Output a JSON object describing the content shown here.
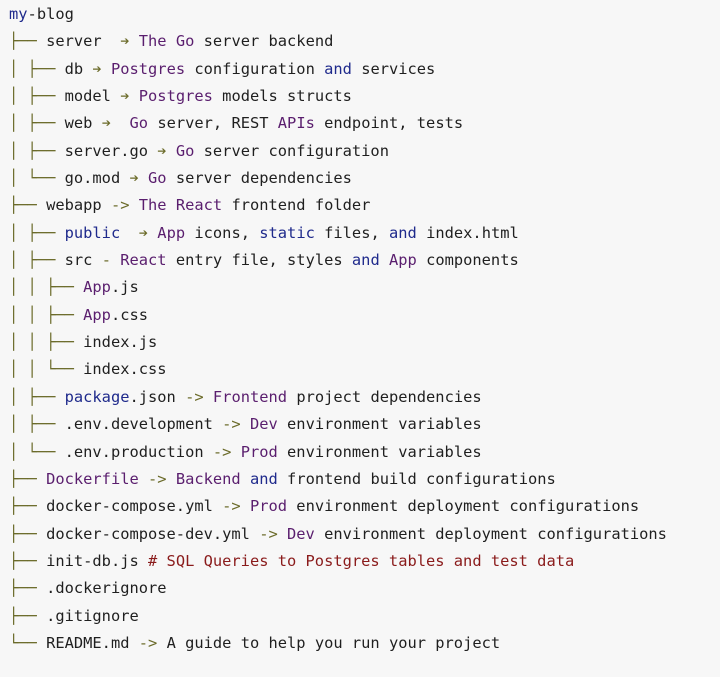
{
  "lines": [
    {
      "tree": "",
      "segs": [
        {
          "t": "my",
          "c": "navy"
        },
        {
          "t": "-",
          "c": "black"
        },
        {
          "t": "blog",
          "c": "black"
        }
      ]
    },
    {
      "tree": "├── ",
      "segs": [
        {
          "t": "server  ",
          "c": "black"
        },
        {
          "t": "➔ ",
          "c": "olive"
        },
        {
          "t": "The Go ",
          "c": "purple"
        },
        {
          "t": "server backend",
          "c": "black"
        }
      ]
    },
    {
      "tree": "│ ├── ",
      "segs": [
        {
          "t": "db ",
          "c": "black"
        },
        {
          "t": "➔ ",
          "c": "olive"
        },
        {
          "t": "Postgres ",
          "c": "purple"
        },
        {
          "t": "configuration ",
          "c": "black"
        },
        {
          "t": "and ",
          "c": "navy"
        },
        {
          "t": "services",
          "c": "black"
        }
      ]
    },
    {
      "tree": "│ ├── ",
      "segs": [
        {
          "t": "model ",
          "c": "black"
        },
        {
          "t": "➔ ",
          "c": "olive"
        },
        {
          "t": "Postgres ",
          "c": "purple"
        },
        {
          "t": "models structs",
          "c": "black"
        }
      ]
    },
    {
      "tree": "│ ├── ",
      "segs": [
        {
          "t": "web ",
          "c": "black"
        },
        {
          "t": "➔  ",
          "c": "olive"
        },
        {
          "t": "Go ",
          "c": "purple"
        },
        {
          "t": "server, REST ",
          "c": "black"
        },
        {
          "t": "APIs ",
          "c": "purple"
        },
        {
          "t": "endpoint, tests",
          "c": "black"
        }
      ]
    },
    {
      "tree": "│ ├── ",
      "segs": [
        {
          "t": "server.go ",
          "c": "black"
        },
        {
          "t": "➔ ",
          "c": "olive"
        },
        {
          "t": "Go ",
          "c": "purple"
        },
        {
          "t": "server configuration",
          "c": "black"
        }
      ]
    },
    {
      "tree": "│ └── ",
      "segs": [
        {
          "t": "go.mod ",
          "c": "black"
        },
        {
          "t": "➔ ",
          "c": "olive"
        },
        {
          "t": "Go ",
          "c": "purple"
        },
        {
          "t": "server dependencies",
          "c": "black"
        }
      ]
    },
    {
      "tree": "├── ",
      "segs": [
        {
          "t": "webapp ",
          "c": "black"
        },
        {
          "t": "-> ",
          "c": "olive"
        },
        {
          "t": "The React ",
          "c": "purple"
        },
        {
          "t": "frontend folder",
          "c": "black"
        }
      ]
    },
    {
      "tree": "│ ├── ",
      "segs": [
        {
          "t": "public  ",
          "c": "navy"
        },
        {
          "t": "➔ ",
          "c": "olive"
        },
        {
          "t": "App ",
          "c": "purple"
        },
        {
          "t": "icons, ",
          "c": "black"
        },
        {
          "t": "static ",
          "c": "navy"
        },
        {
          "t": "files, ",
          "c": "black"
        },
        {
          "t": "and ",
          "c": "navy"
        },
        {
          "t": "index",
          "c": "black"
        },
        {
          "t": ".",
          "c": "black"
        },
        {
          "t": "html",
          "c": "black"
        }
      ]
    },
    {
      "tree": "│ ├── ",
      "segs": [
        {
          "t": "src ",
          "c": "black"
        },
        {
          "t": "- ",
          "c": "olive"
        },
        {
          "t": "React ",
          "c": "purple"
        },
        {
          "t": "entry file, styles ",
          "c": "black"
        },
        {
          "t": "and ",
          "c": "navy"
        },
        {
          "t": "App ",
          "c": "purple"
        },
        {
          "t": "components",
          "c": "black"
        }
      ]
    },
    {
      "tree": "│ │ ├── ",
      "segs": [
        {
          "t": "App",
          "c": "purple"
        },
        {
          "t": ".js",
          "c": "black"
        }
      ]
    },
    {
      "tree": "│ │ ├── ",
      "segs": [
        {
          "t": "App",
          "c": "purple"
        },
        {
          "t": ".css",
          "c": "black"
        }
      ]
    },
    {
      "tree": "│ │ ├── ",
      "segs": [
        {
          "t": "index.js",
          "c": "black"
        }
      ]
    },
    {
      "tree": "│ │ └── ",
      "segs": [
        {
          "t": "index.css",
          "c": "black"
        }
      ]
    },
    {
      "tree": "│ ├── ",
      "segs": [
        {
          "t": "package",
          "c": "navy"
        },
        {
          "t": ".json ",
          "c": "black"
        },
        {
          "t": "-> ",
          "c": "olive"
        },
        {
          "t": "Frontend ",
          "c": "purple"
        },
        {
          "t": "project dependencies",
          "c": "black"
        }
      ]
    },
    {
      "tree": "│ ├── ",
      "segs": [
        {
          "t": ".env.development ",
          "c": "black"
        },
        {
          "t": "-> ",
          "c": "olive"
        },
        {
          "t": "Dev ",
          "c": "purple"
        },
        {
          "t": "environment variables",
          "c": "black"
        }
      ]
    },
    {
      "tree": "│ └── ",
      "segs": [
        {
          "t": ".env.production ",
          "c": "black"
        },
        {
          "t": "-> ",
          "c": "olive"
        },
        {
          "t": "Prod ",
          "c": "purple"
        },
        {
          "t": "environment variables",
          "c": "black"
        }
      ]
    },
    {
      "tree": "├── ",
      "segs": [
        {
          "t": "Dockerfile ",
          "c": "purple"
        },
        {
          "t": "-> ",
          "c": "olive"
        },
        {
          "t": "Backend ",
          "c": "purple"
        },
        {
          "t": "and ",
          "c": "navy"
        },
        {
          "t": "frontend build configurations",
          "c": "black"
        }
      ]
    },
    {
      "tree": "├── ",
      "segs": [
        {
          "t": "docker-compose.yml ",
          "c": "black"
        },
        {
          "t": "-> ",
          "c": "olive"
        },
        {
          "t": "Prod ",
          "c": "purple"
        },
        {
          "t": "environment deployment configurations",
          "c": "black"
        }
      ]
    },
    {
      "tree": "├── ",
      "segs": [
        {
          "t": "docker-compose-dev.yml ",
          "c": "black"
        },
        {
          "t": "-> ",
          "c": "olive"
        },
        {
          "t": "Dev ",
          "c": "purple"
        },
        {
          "t": "environment deployment configurations",
          "c": "black"
        }
      ]
    },
    {
      "tree": "├── ",
      "segs": [
        {
          "t": "init-db.js ",
          "c": "black"
        },
        {
          "t": "# SQL Queries to Postgres tables and test data",
          "c": "red"
        }
      ]
    },
    {
      "tree": "├── ",
      "segs": [
        {
          "t": ".dockerignore",
          "c": "black"
        }
      ]
    },
    {
      "tree": "├── ",
      "segs": [
        {
          "t": ".gitignore",
          "c": "black"
        }
      ]
    },
    {
      "tree": "└── ",
      "segs": [
        {
          "t": "README.md ",
          "c": "black"
        },
        {
          "t": "-> ",
          "c": "olive"
        },
        {
          "t": "A guide to help you run your project",
          "c": "black"
        }
      ]
    }
  ]
}
